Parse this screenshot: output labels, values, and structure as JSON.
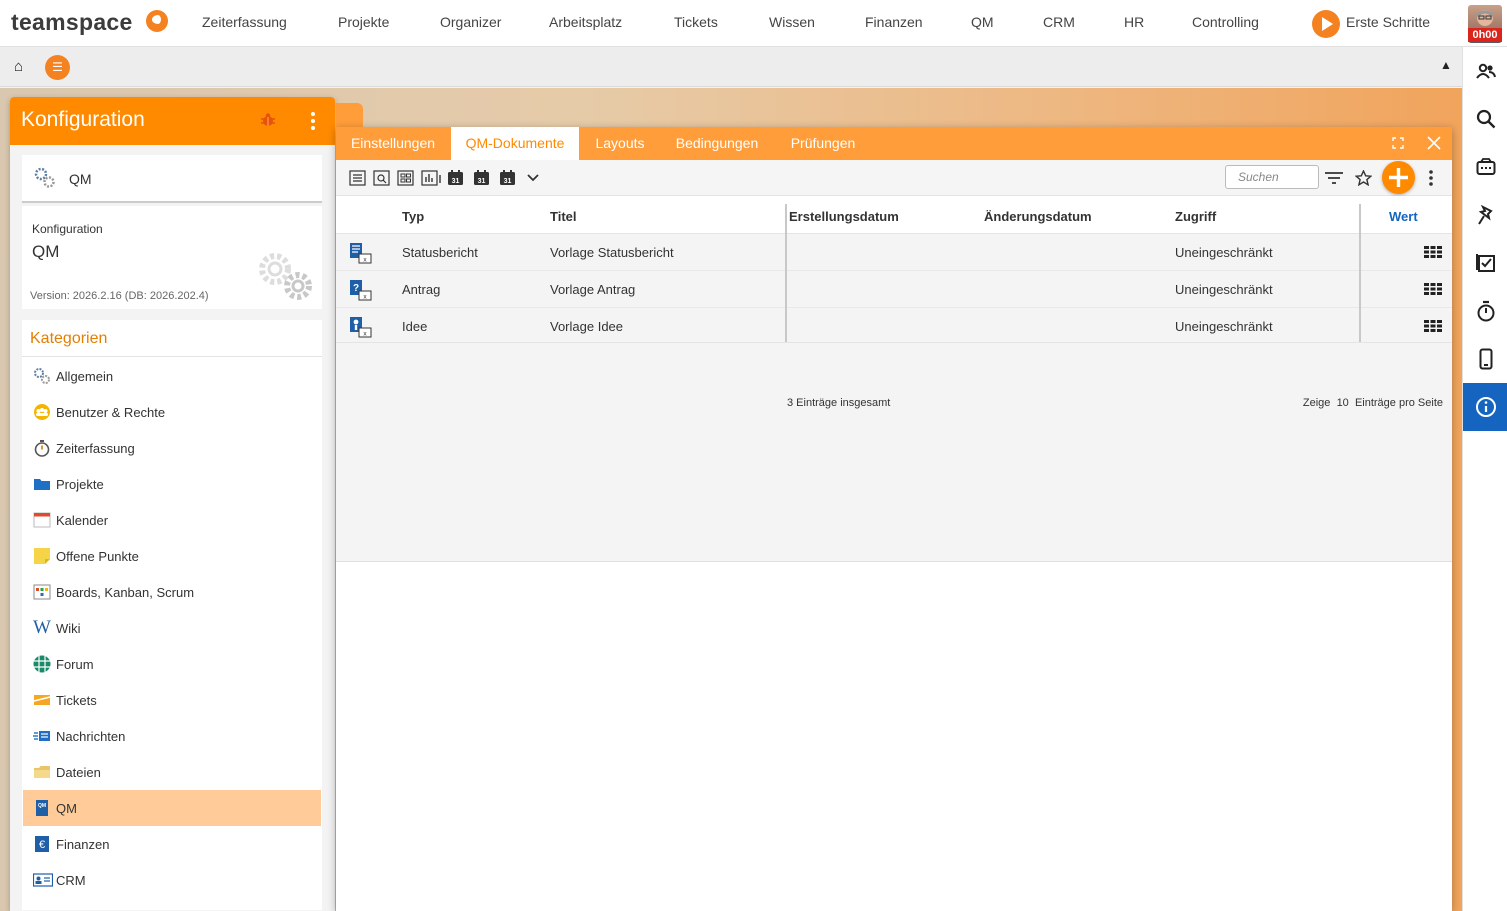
{
  "app": {
    "logo_text": "teamspace",
    "nav": [
      "Zeiterfassung",
      "Projekte",
      "Organizer",
      "Arbeitsplatz",
      "Tickets",
      "Wissen",
      "Finanzen",
      "QM",
      "CRM",
      "HR",
      "Controlling"
    ],
    "start_label": "Erste Schritte",
    "avatar_time": "0h00"
  },
  "config_panel": {
    "title": "Konfiguration",
    "module_label": "QM",
    "sub_label": "Konfiguration",
    "name": "QM",
    "version": "Version: 2026.2.16 (DB: 2026.202.4)",
    "categories_title": "Kategorien",
    "categories": [
      {
        "label": "Allgemein",
        "icon": "gears-icon"
      },
      {
        "label": "Benutzer & Rechte",
        "icon": "users-icon"
      },
      {
        "label": "Zeiterfassung",
        "icon": "stopwatch-icon"
      },
      {
        "label": "Projekte",
        "icon": "folder-icon"
      },
      {
        "label": "Kalender",
        "icon": "calendar-icon"
      },
      {
        "label": "Offene Punkte",
        "icon": "sticky-note-icon"
      },
      {
        "label": "Boards, Kanban, Scrum",
        "icon": "board-icon"
      },
      {
        "label": "Wiki",
        "icon": "wiki-icon"
      },
      {
        "label": "Forum",
        "icon": "forum-icon"
      },
      {
        "label": "Tickets",
        "icon": "ticket-icon"
      },
      {
        "label": "Nachrichten",
        "icon": "messages-icon"
      },
      {
        "label": "Dateien",
        "icon": "files-icon"
      },
      {
        "label": "QM",
        "icon": "qm-icon",
        "selected": true
      },
      {
        "label": "Finanzen",
        "icon": "euro-icon"
      },
      {
        "label": "CRM",
        "icon": "contact-card-icon"
      }
    ]
  },
  "window": {
    "tabs": [
      "Einstellungen",
      "QM-Dokumente",
      "Layouts",
      "Bedingungen",
      "Prüfungen"
    ],
    "active_tab": "QM-Dokumente",
    "search_placeholder": "Suchen",
    "columns": [
      "Typ",
      "Titel",
      "Erstellungsdatum",
      "Änderungsdatum",
      "Zugriff",
      "Wert"
    ],
    "rows": [
      {
        "typ": "Statusbericht",
        "titel": "Vorlage Statusbericht",
        "erstellt": "",
        "geaendert": "",
        "zugriff": "Uneingeschränkt"
      },
      {
        "typ": "Antrag",
        "titel": "Vorlage Antrag",
        "erstellt": "",
        "geaendert": "",
        "zugriff": "Uneingeschränkt"
      },
      {
        "typ": "Idee",
        "titel": "Vorlage Idee",
        "erstellt": "",
        "geaendert": "",
        "zugriff": "Uneingeschränkt"
      }
    ],
    "total_text": "3 Einträge insgesamt",
    "pager_prefix": "Zeige",
    "page_size": "10",
    "pager_suffix": "Einträge pro Seite"
  },
  "colors": {
    "accent": "#ff8a00",
    "tab_bar": "#ff9d3a",
    "selected_category": "#ffcc99",
    "active_sidebar": "#1565c0"
  }
}
